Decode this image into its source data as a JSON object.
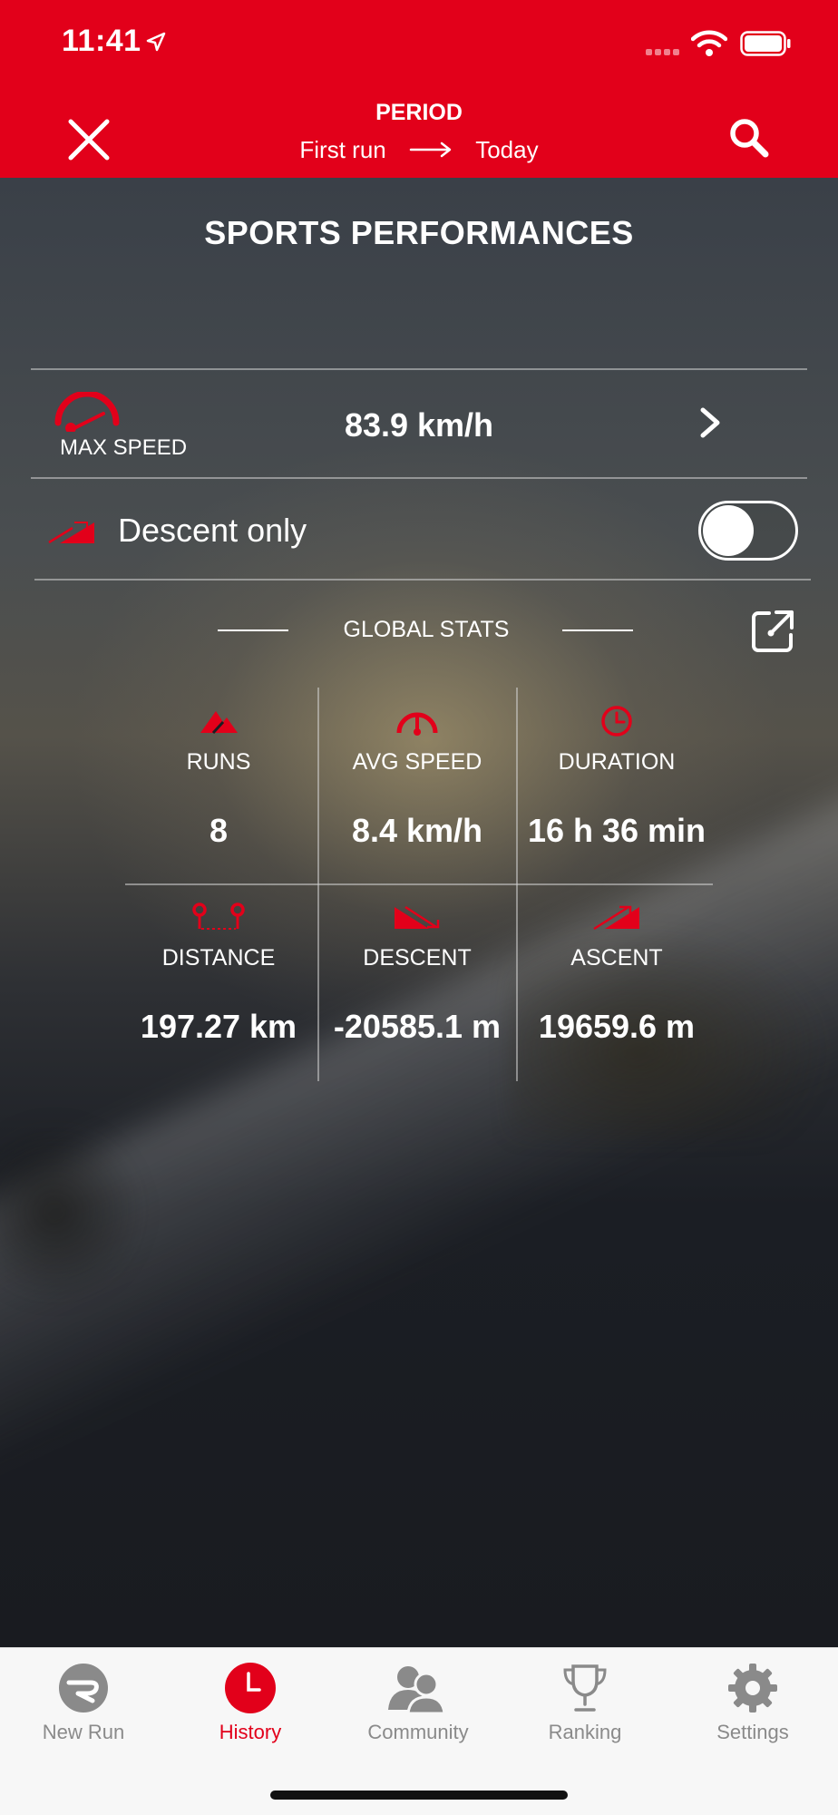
{
  "status_bar": {
    "time": "11:41"
  },
  "header": {
    "period_label": "PERIOD",
    "range_start": "First run",
    "range_end": "Today",
    "accent_color": "#e2001a"
  },
  "page": {
    "title": "SPORTS PERFORMANCES"
  },
  "max_speed": {
    "label": "MAX SPEED",
    "value": "83.9 km/h"
  },
  "descent_only": {
    "label": "Descent only",
    "enabled": false
  },
  "global_stats": {
    "title": "GLOBAL STATS",
    "cells": [
      {
        "icon": "runs-icon",
        "label": "RUNS",
        "value": "8"
      },
      {
        "icon": "avg-speed-icon",
        "label": "AVG SPEED",
        "value": "8.4 km/h"
      },
      {
        "icon": "duration-icon",
        "label": "DURATION",
        "value": "16 h 36 min"
      },
      {
        "icon": "distance-icon",
        "label": "DISTANCE",
        "value": "197.27 km"
      },
      {
        "icon": "descent-icon",
        "label": "DESCENT",
        "value": "-20585.1 m"
      },
      {
        "icon": "ascent-icon",
        "label": "ASCENT",
        "value": "19659.6 m"
      }
    ]
  },
  "tabbar": {
    "tabs": [
      {
        "icon": "new-run-icon",
        "label": "New Run",
        "active": false
      },
      {
        "icon": "history-icon",
        "label": "History",
        "active": true
      },
      {
        "icon": "community-icon",
        "label": "Community",
        "active": false
      },
      {
        "icon": "ranking-icon",
        "label": "Ranking",
        "active": false
      },
      {
        "icon": "settings-icon",
        "label": "Settings",
        "active": false
      }
    ]
  }
}
